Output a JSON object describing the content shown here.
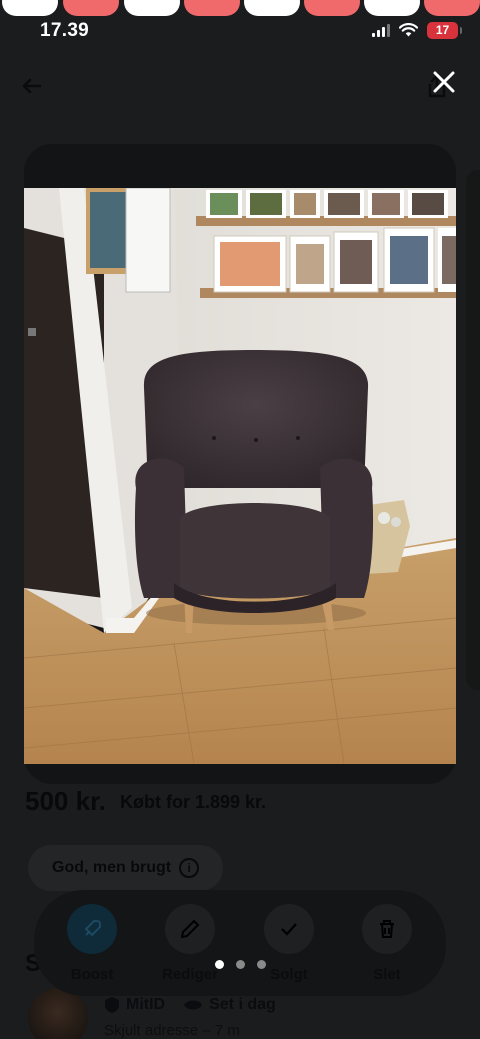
{
  "status_bar": {
    "time": "17.39",
    "battery": "17"
  },
  "listing": {
    "price": "500 kr.",
    "original_price": "Købt for 1.899 kr.",
    "condition": "God, men brugt",
    "section_initial": "S",
    "seller": {
      "badge_mitid": "MitID",
      "badge_sent": "Set i dag",
      "subtitle": "Skjult adresse – 7 m"
    }
  },
  "toolbar": {
    "items": [
      {
        "label": "Boost",
        "icon": "rocket-icon"
      },
      {
        "label": "Rediger",
        "icon": "pencil-icon"
      },
      {
        "label": "Solgt",
        "icon": "checkmark-icon"
      },
      {
        "label": "Slet",
        "icon": "trash-icon"
      }
    ]
  },
  "viewer": {
    "photo_subject": "Dark brown bouclé wingback armchair in a room corner",
    "page_count": 3,
    "current_page": 1
  },
  "colors": {
    "overlay": "#1b1c1e",
    "bubble_white": "#ffffff",
    "bubble_red": "#f0696b",
    "battery": "#d8333c"
  }
}
